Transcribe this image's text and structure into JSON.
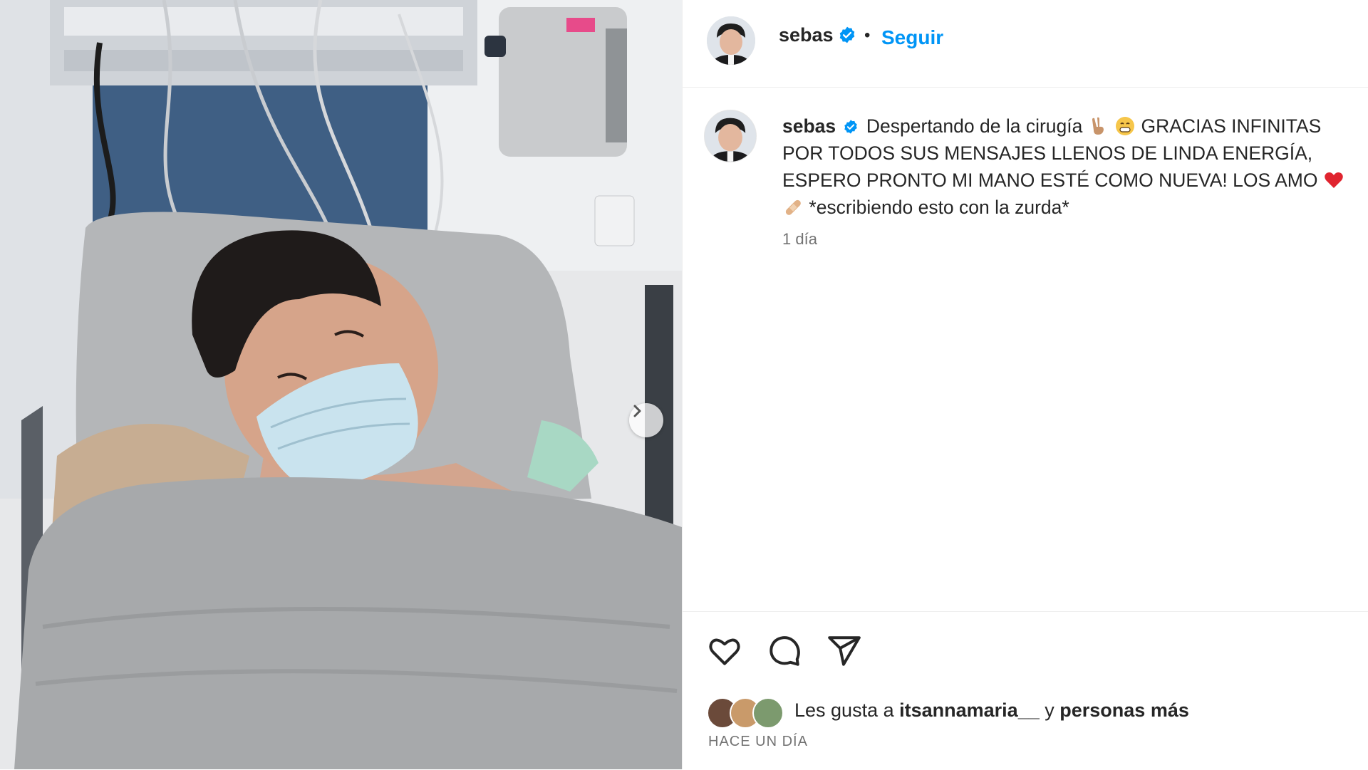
{
  "header": {
    "username": "sebas",
    "separator": "•",
    "follow_label": "Seguir"
  },
  "caption": {
    "username": "sebas",
    "text_part1": "Despertando de la cirugía",
    "text_part2": "GRACIAS INFINITAS POR TODOS SUS MENSAJES LLENOS DE LINDA ENERGÍA, ESPERO PRONTO MI MANO ESTÉ COMO NUEVA! LOS AMO",
    "text_part3": "*escribiendo esto con la zurda*",
    "emojis": [
      "victory-hand-emoji",
      "grimacing-face-emoji",
      "red-heart-emoji",
      "bandage-emoji"
    ],
    "time": "1 día"
  },
  "likes": {
    "prefix": "Les gusta a",
    "user": "itsannamaria__",
    "connector": "y",
    "others": "personas más"
  },
  "post_age": "HACE UN DÍA",
  "icons": [
    "heart-icon",
    "comment-icon",
    "share-icon",
    "chevron-right-icon",
    "verified-badge-icon"
  ],
  "colors": {
    "link": "#0095f6",
    "verified": "#0095f6",
    "text": "#262626",
    "muted": "#737373"
  }
}
